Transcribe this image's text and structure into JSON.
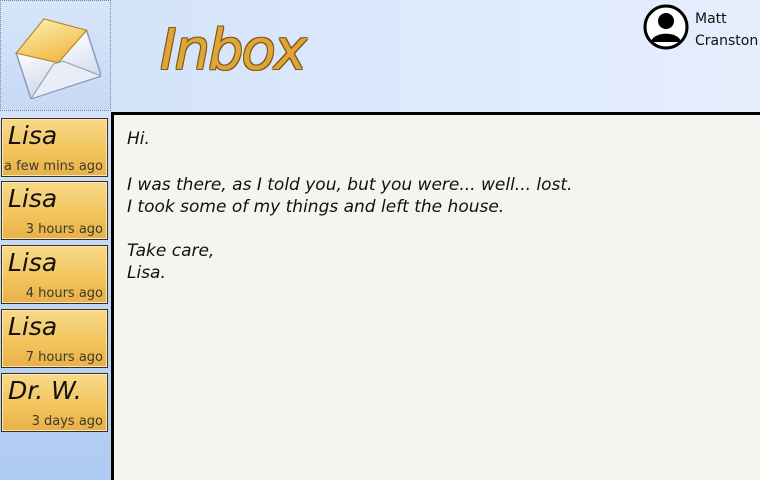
{
  "header": {
    "title": "Inbox",
    "app_icon": "envelope-icon",
    "user": {
      "name": "Matt\nCranston",
      "avatar_icon": "user-silhouette-icon"
    }
  },
  "messages": [
    {
      "sender": "Lisa",
      "time": "a few mins ago"
    },
    {
      "sender": "Lisa",
      "time": "3 hours ago"
    },
    {
      "sender": "Lisa",
      "time": "4 hours ago"
    },
    {
      "sender": "Lisa",
      "time": "7 hours ago"
    },
    {
      "sender": "Dr. W.",
      "time": "3 days ago"
    }
  ],
  "open_message": {
    "lines": [
      "Hi.",
      "",
      "I was there, as I told you, but you were... well... lost.",
      "I took some of my things and left the house.",
      "",
      "Take care,",
      "Lisa."
    ]
  },
  "colors": {
    "accent_title": "#e0a43a",
    "message_item": "#f2c35a",
    "panel_bg": "#f5f4ee"
  }
}
